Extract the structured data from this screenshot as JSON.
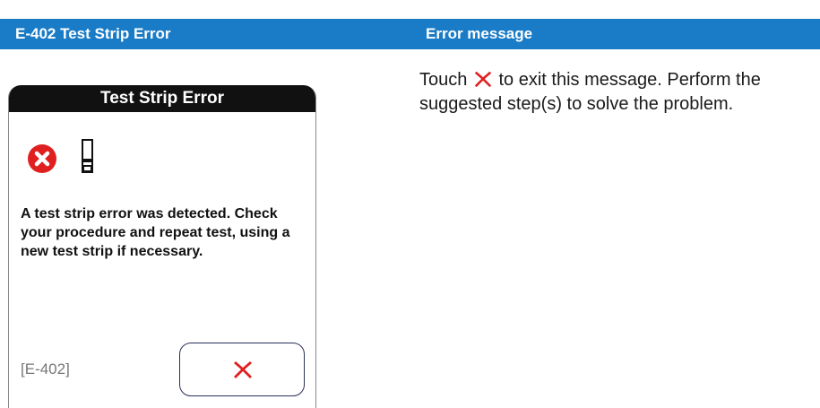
{
  "header": {
    "left_title": "E-402 Test Strip Error",
    "right_title": "Error message"
  },
  "instruction": {
    "before_icon": "Touch",
    "after_icon": "to exit this message. Perform the suggested step(s) to solve the problem.",
    "icon": "red-x-icon"
  },
  "device": {
    "title": "Test Strip Error",
    "message": "A test strip error was detected. Check your procedure and repeat test, using a new test strip if necessary.",
    "code": "[E-402]",
    "icons": [
      "error-circle-icon",
      "test-strip-icon",
      "close-x-icon"
    ]
  },
  "colors": {
    "header_bg": "#1a7cc7",
    "error_red": "#e02020",
    "device_title_bg": "#111111"
  }
}
